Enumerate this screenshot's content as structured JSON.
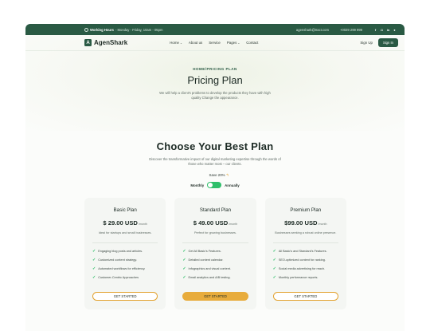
{
  "topbar": {
    "working_hours_label": "Working Hours",
    "working_hours_value": "- Monday - Friday, 10am - 05pm",
    "email": "agenshark@tract.com",
    "phone": "+0029 299 999",
    "socials": [
      "f",
      "◘",
      "in",
      "●"
    ]
  },
  "nav": {
    "logo_text": "AgenShark",
    "logo_letter": "A",
    "items": [
      {
        "label": "Home",
        "has_chevron": true
      },
      {
        "label": "About us",
        "has_chevron": false
      },
      {
        "label": "Service",
        "has_chevron": false
      },
      {
        "label": "Pages",
        "has_chevron": true
      },
      {
        "label": "Contact",
        "has_chevron": false
      }
    ],
    "chevron": "⌄",
    "signup": "Sign Up",
    "signin": "Sign In"
  },
  "hero": {
    "breadcrumb": "HOME/PRICING PLAN",
    "title": "Pricing Plan",
    "subtitle": "We will help a client's problems to develop the products they have with high quality Change the appearance."
  },
  "plans_section": {
    "title": "Choose Your Best Plan",
    "subtitle": "Discover the transformative impact of our digital marketing expertise through the words of those who matter most – our clients.",
    "save_text": "Save 20%",
    "save_arrow": "↰",
    "toggle_left": "Monthly",
    "toggle_right": "Annually"
  },
  "plans": [
    {
      "name": "Basic Plan",
      "price": "$ 29.00 USD",
      "period": "/month",
      "description": "Ideal for startups and small businesses.",
      "features": [
        "Engaging blog posts and articles.",
        "Customized content strategy.",
        "Automated workflows for efficiency.",
        "Customer-Centric Approaches"
      ],
      "cta": "GET STARTED",
      "highlighted": false
    },
    {
      "name": "Standard Plan",
      "price": "$ 49.00 USD",
      "period": "/month",
      "description": "Perfect for growing businesses.",
      "features": [
        "Get All Basic's Features.",
        "Detailed content calendar.",
        "Infographics and visual content.",
        "Email analytics and A/B testing."
      ],
      "cta": "GET STARTED",
      "highlighted": true
    },
    {
      "name": "Premium Plan",
      "price": "$99.00 USD",
      "period": "/month",
      "description": "Businesses seeking a robust online presence.",
      "features": [
        "All Basic's and Standard's Features.",
        "SEO-optimized content for ranking.",
        "Social media advertising for reach.",
        "Monthly performance reports."
      ],
      "cta": "GET STARTED",
      "highlighted": false
    }
  ],
  "check_glyph": "✓",
  "colors": {
    "brand_green": "#2a5a44",
    "accent_orange": "#e8ac3c",
    "toggle_green": "#2fbf6a"
  }
}
